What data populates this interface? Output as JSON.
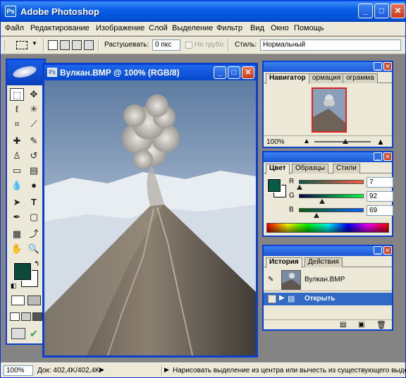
{
  "app": {
    "title": "Adobe Photoshop",
    "icon_text": "Ps",
    "controls": {
      "minimize": "_",
      "maximize": "□",
      "close": "✕"
    }
  },
  "menu": [
    "Файл",
    "Редактирование",
    "Изображение",
    "Слой",
    "Выделение",
    "Фильтр",
    "Вид",
    "Окно",
    "Помощь"
  ],
  "options_bar": {
    "feather_label": "Растушевать:",
    "feather_value": "0 пкс",
    "antialias_label": "Не грубо",
    "style_label": "Стиль:",
    "style_value": "Нормальный"
  },
  "document": {
    "title": "Вулкан.BMP @ 100% (RGB/8)"
  },
  "navigator": {
    "tabs": [
      "Навигатор",
      "ормация",
      "ограмма"
    ],
    "zoom": "100%"
  },
  "color_panel": {
    "tabs": [
      "Цвет",
      "Образцы",
      "Стили"
    ],
    "channels": [
      {
        "label": "R",
        "value": "7",
        "color": "#ff0000"
      },
      {
        "label": "G",
        "value": "92",
        "color": "#00ff00"
      },
      {
        "label": "B",
        "value": "69",
        "color": "#0000ff"
      }
    ],
    "foreground": "#075c45"
  },
  "history": {
    "tabs": [
      "История",
      "Действия"
    ],
    "snapshot_label": "Вулкан.BMP",
    "step_label": "Открыть"
  },
  "status": {
    "zoom": "100%",
    "doc_info": "Док: 402,4K/402,4K",
    "hint": "Нарисовать выделение из центра или вычесть из существующего выделе"
  },
  "colors": {
    "xp_blue": "#0b3fd0",
    "selected_row": "#316ac5"
  }
}
